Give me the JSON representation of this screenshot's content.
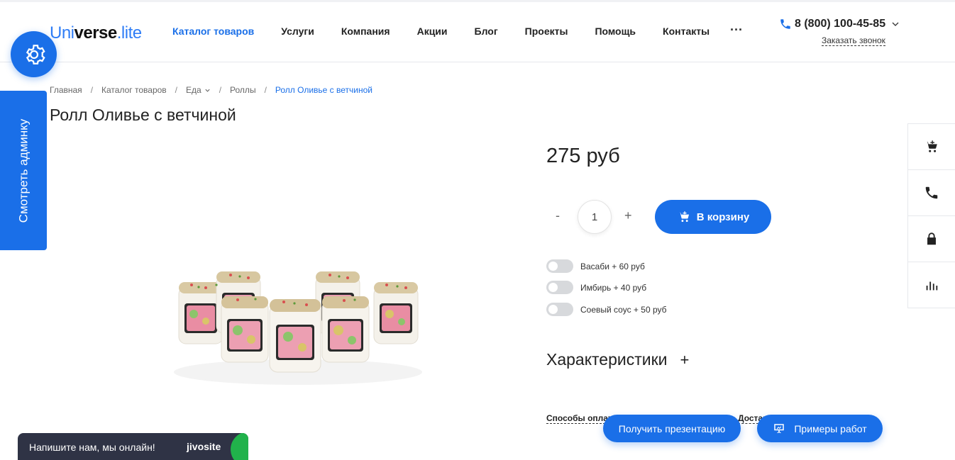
{
  "header": {
    "logo": {
      "part1": "Uni",
      "part2": "verse",
      "part3": ".lite"
    },
    "menu": [
      {
        "label": "Каталог товаров",
        "active": true
      },
      {
        "label": "Услуги",
        "active": false
      },
      {
        "label": "Компания",
        "active": false
      },
      {
        "label": "Акции",
        "active": false
      },
      {
        "label": "Блог",
        "active": false
      },
      {
        "label": "Проекты",
        "active": false
      },
      {
        "label": "Помощь",
        "active": false
      },
      {
        "label": "Контакты",
        "active": false
      }
    ],
    "more": "···",
    "phone": "8 (800) 100-45-85",
    "callback": "Заказать звонок"
  },
  "admin_tab": {
    "label": "Смотреть админку"
  },
  "breadcrumbs": [
    "Главная",
    "Каталог товаров",
    "Еда",
    "Роллы",
    "Ролл Оливье с ветчиной"
  ],
  "product": {
    "title": "Ролл Оливье с ветчиной",
    "price": "275 руб",
    "quantity": "1",
    "qty_minus": "-",
    "qty_plus": "+",
    "add_to_cart": "В корзину",
    "options": [
      {
        "label": "Васаби + 60 руб",
        "on": false
      },
      {
        "label": "Имбирь + 40 руб",
        "on": false
      },
      {
        "label": "Соевый соус + 50 руб",
        "on": false
      }
    ],
    "characteristics": "Характеристики",
    "characteristics_toggle": "+",
    "payment_link": "Способы оплаты",
    "delivery_link": "Доставка"
  },
  "float_buttons": {
    "presentation": "Получить презентацию",
    "works": "Примеры работ"
  },
  "side_panel": [
    "cart-icon",
    "phone-icon",
    "lock-icon",
    "chart-icon"
  ],
  "chat": {
    "text": "Напишите нам, мы онлайн!",
    "brand": "jivosite"
  },
  "colors": {
    "accent": "#1a6fe8",
    "dark": "#2f3345",
    "chat_green": "#21b24b"
  }
}
